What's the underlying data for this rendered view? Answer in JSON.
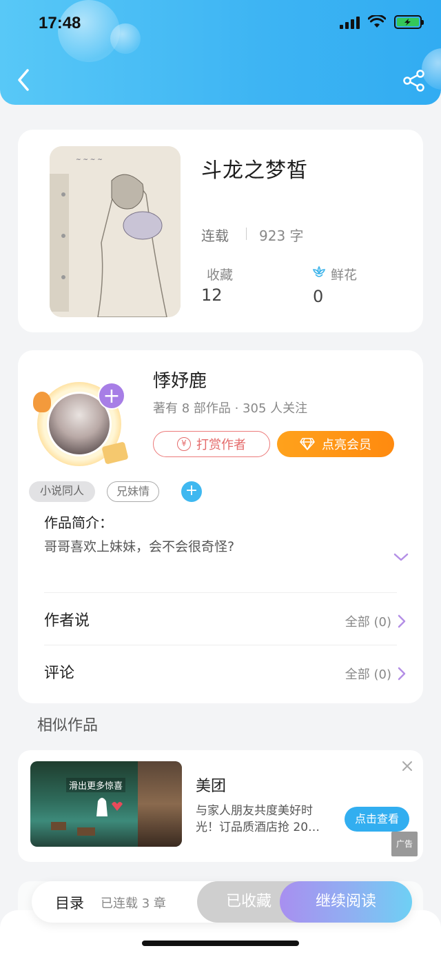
{
  "status_bar": {
    "time": "17:48"
  },
  "book": {
    "title": "斗龙之梦皙",
    "status": "连载",
    "words": "923 字",
    "fav_label": "收藏",
    "fav_count": "12",
    "flower_label": "鲜花",
    "flower_count": "0"
  },
  "author": {
    "name": "悸妤鹿",
    "meta": "著有 8 部作品 · 305 人关注",
    "tip_label": "打赏作者",
    "tip_icon_glyph": "¥",
    "vip_label": "点亮会员"
  },
  "tags": [
    "小说同人",
    "兄妹情"
  ],
  "intro": {
    "title": "作品简介：",
    "text": "哥哥喜欢上妹妹，会不会很奇怪?"
  },
  "author_says": {
    "label": "作者说",
    "right": "全部 (0)"
  },
  "comments": {
    "label": "评论",
    "right": "全部 (0)"
  },
  "similar_title": "相似作品",
  "ad": {
    "title": "美团",
    "desc": "与家人朋友共度美好时光！订品质酒店抢 20…",
    "button": "点击查看",
    "overlay_text": "滑出更多惊喜",
    "tag": "广告"
  },
  "bottom_bar": {
    "toc": "目录",
    "chapters": "已连载 3 章",
    "collected": "已收藏",
    "read": "继续阅读"
  },
  "colors": {
    "header": "#3db4f3",
    "accent_purple": "#a77ee6",
    "vip_orange": "#ff8a0f",
    "tip_red": "#e46a6a"
  }
}
